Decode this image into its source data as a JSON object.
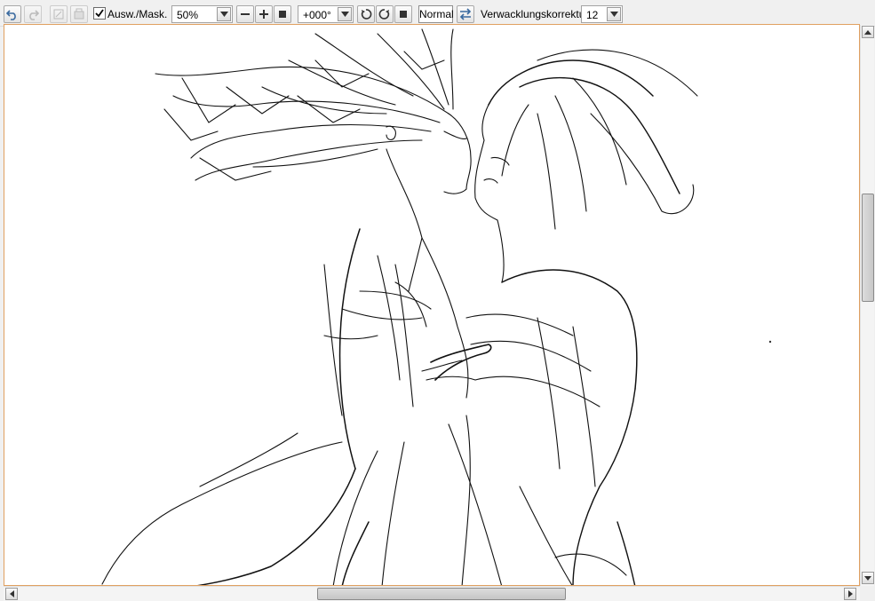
{
  "toolbar": {
    "undo_icon": "undo-icon",
    "redo_icon": "redo-icon",
    "selection_mask_checked": true,
    "selection_mask_label": "Ausw./Mask.",
    "zoom_value": "50%",
    "rotation_value": "+000°",
    "blend_mode": "Normal",
    "stabilizer_label": "Verwacklungskorrektur",
    "stabilizer_value": "12"
  },
  "scrollbars": {
    "vertical_thumb_fraction_start": 0.3,
    "vertical_thumb_fraction_size": 0.2,
    "horizontal_thumb_fraction_start": 0.36,
    "horizontal_thumb_fraction_size": 0.3
  }
}
